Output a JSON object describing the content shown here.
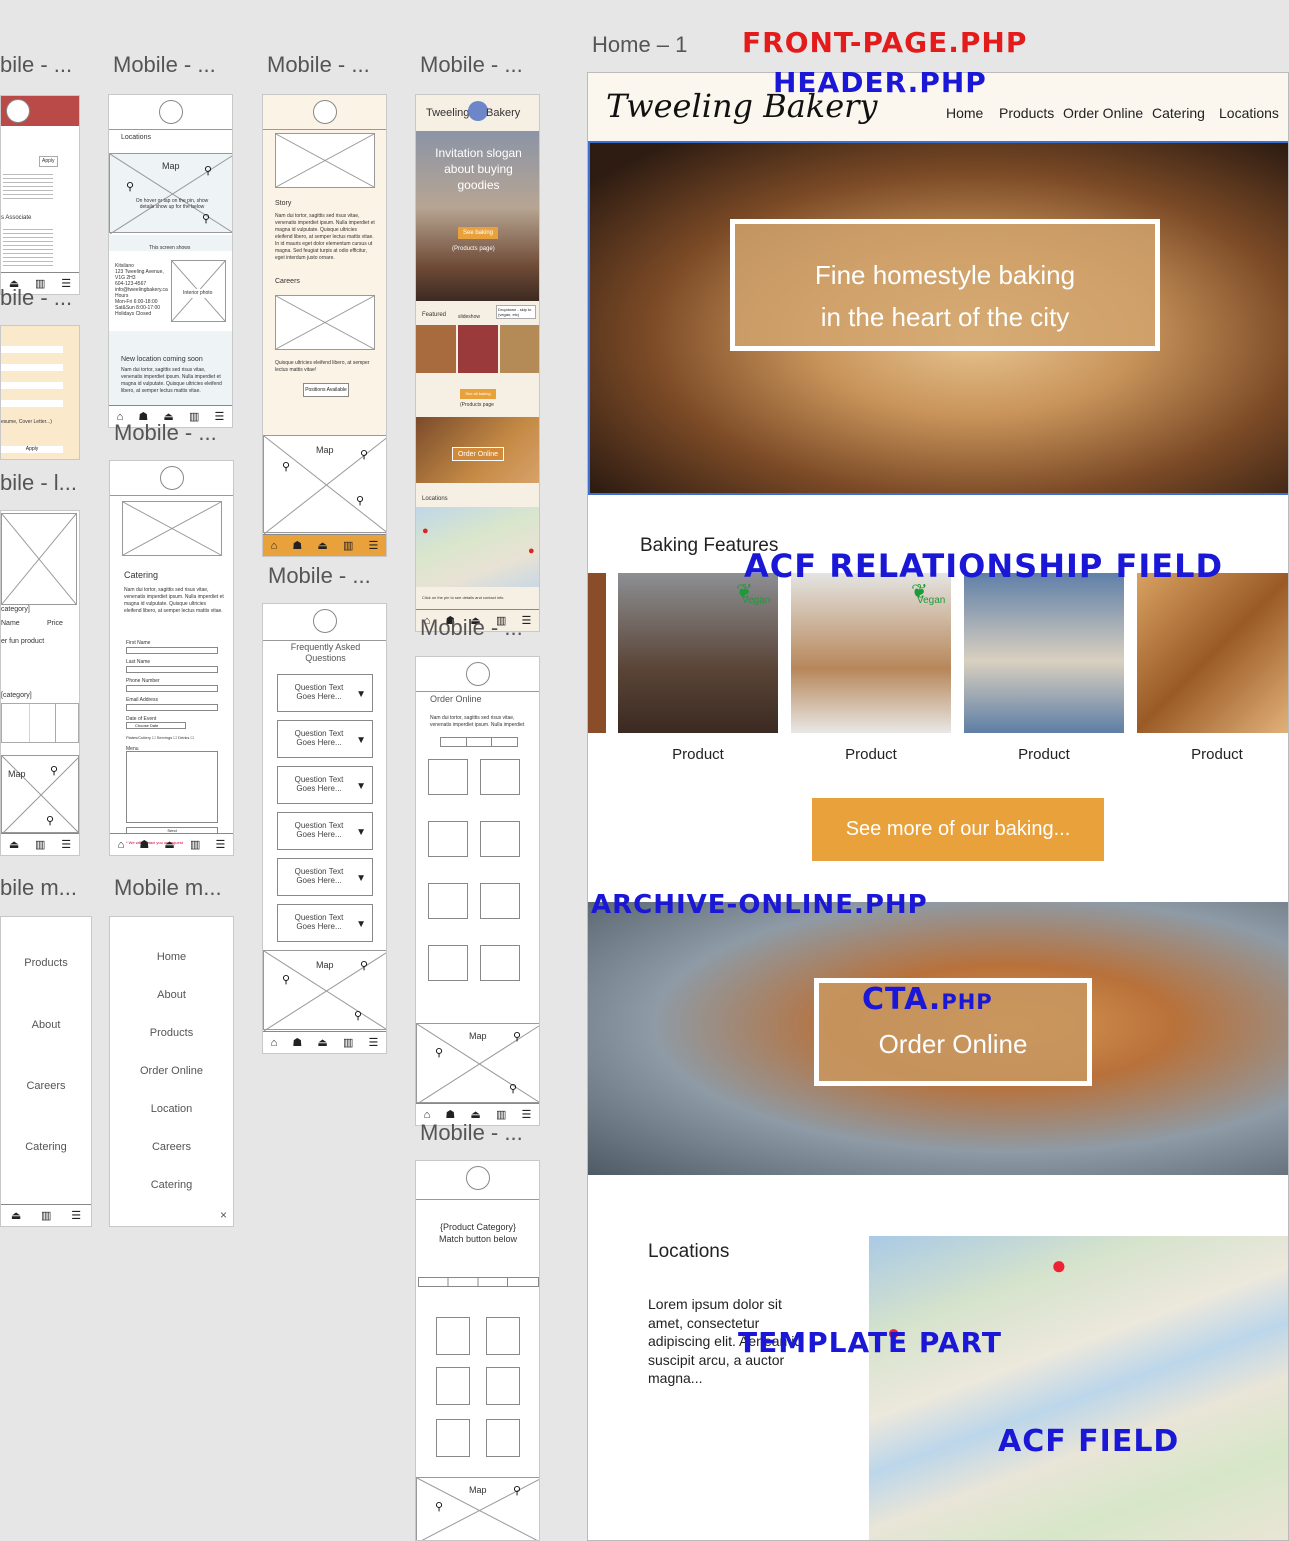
{
  "artboard_labels": {
    "col1_top": "bile - ...",
    "col2_top": "Mobile - ...",
    "col3_top": "Mobile - ...",
    "col4_top": "Mobile - ...",
    "col1_mid": "bile - ...",
    "col2_mid": "Mobile - ...",
    "col1_low": "bile - l...",
    "col3_mid": "Mobile - ...",
    "col4_mid": "Mobile - ...",
    "col1_menu": "bile m...",
    "col2_menu": "Mobile m...",
    "col4_low": "Mobile - ...",
    "home": "Home – 1"
  },
  "annotations": {
    "front_page": "Front-page.php",
    "header": "header.php",
    "acf_relationship": "ACF Relationship Field",
    "archive_online": "archive-online.php",
    "cta": "CTA.php",
    "template_part": "template part",
    "acf_field": "ACF field"
  },
  "site": {
    "logo": "Tweeling Bakery",
    "nav": [
      "Home",
      "Products",
      "Order Online",
      "Catering",
      "Locations"
    ],
    "hero_line1": "Fine homestyle baking",
    "hero_line2": "in the heart of the city",
    "features_heading": "Baking Features",
    "products": [
      {
        "label": "Product",
        "badge": "",
        "color": "#6a4a3a"
      },
      {
        "label": "Product",
        "badge": "Vegan",
        "color": "#a5704a"
      },
      {
        "label": "Product",
        "badge": "",
        "color": "#c9b79a"
      },
      {
        "label": "Product",
        "badge": "",
        "color": "#b27a42"
      }
    ],
    "product_badge_first": "Vegan",
    "see_more_button": "See more of our baking...",
    "cta_text": "Order Online",
    "locations_heading": "Locations",
    "locations_text": "Lorem ipsum dolor sit amet, consectetur adipiscing elit. Aenean id suscipit arcu, a auctor magna..."
  },
  "mobile": {
    "locations_title": "Locations",
    "map": "Map",
    "map_hint": "On hover or tap on the pin, show details show up for the below",
    "this_screen": "This screen shows",
    "address": "Kitsilano\n123 Tweeling Avenue,\nV1G 2H3\n604-123-4567\ninfo@tweelingbakery.ca\nHours\nMon-Fri 6:00-18:00\nSat&Sun 8:00-17:00\nHolidays Closed",
    "interior_photo": "Interior photo",
    "new_location": "New location coming soon",
    "new_location_body": "Nam dui tortor, sagittis sed risus vitae, venenatis imperdiet ipsum. Nulla imperdiet et magna id vulputate. Quisque ultricies eleifend libero, at semper lectus mattis vitae.",
    "story_title": "Story",
    "story_body": "Nam dui tortor, sagittis sed risus vitae, venenatis imperdiet ipsum. Nulla imperdiet et magna id vulputate. Quisque ultricies eleifend libero, at semper lectus mattis vitae. In id mauris eget dolor elementum cursus ut magna. Sed feugiat turpis at odio efficitur, eget interdum justo ornare.",
    "careers_title": "Careers",
    "careers_body": "Quisque ultricies eleifend libero, at semper lectus mattis vitae!",
    "positions_button": "Positions Available",
    "bakery_name_left": "Tweeling",
    "bakery_name_right": "Bakery",
    "slogan": "Invitation slogan about buying goodies",
    "see_baking": "See baking",
    "products_page": "(Products page)",
    "featured": "Featured",
    "slideshow": "slideshow",
    "dropdown_note": "Dropdown - skip to (vegan, etc)",
    "see_all_baking": "See all baking",
    "products_page2": "(Products page",
    "order_online": "Order Online",
    "locations_small": "Locations",
    "click_pin": "Click on the pin to see details and contact info.",
    "catering_title": "Catering",
    "catering_body": "Nam dui tortor, sagittis sed risus vitae, venenatis imperdiet ipsum. Nulla imperdiet et magna id vulputate. Quisque ultricies eleifend libero, at semper lectus mattis vitae.",
    "form_labels": [
      "First Name",
      "Last Name",
      "Phone Number",
      "Email Address",
      "Date of Event"
    ],
    "date_placeholder": "Choose Date",
    "checkboxes": "Plates/Cutlery ☐   Servings ☐   Drinks ☐",
    "menu_label": "Menu",
    "send": "Send",
    "contact_note": "* We will contact you on request",
    "faq_title": "Frequently Asked Questions",
    "faq_q": "Question Text Goes Here...",
    "order_online_title": "Order Online",
    "order_body": "Nam dui tortor, sagittis sed risus vitae, venenatis imperdiet ipsum. Nulla imperdiet",
    "product_category": "{Product Category} Match button below",
    "price_hdr": "Price",
    "category": "category]",
    "name_hdr": "Name",
    "fun_product": "er fun product",
    "category2": "[category]",
    "menu_items_a": [
      "Products",
      "About",
      "Careers",
      "Catering"
    ],
    "menu_items_b": [
      "Home",
      "About",
      "Products",
      "Order Online",
      "Location",
      "Careers",
      "Catering"
    ],
    "apply": "Apply",
    "associate": "s Associate",
    "resume": "esume, Cover Letter...)"
  },
  "colors": {
    "annotation_red": "#e31b1b",
    "annotation_blue": "#1a17d6",
    "cta_orange": "#e9a23b",
    "hero_tint": "#d6b07d",
    "mobile_bar": "#e9a23b"
  }
}
